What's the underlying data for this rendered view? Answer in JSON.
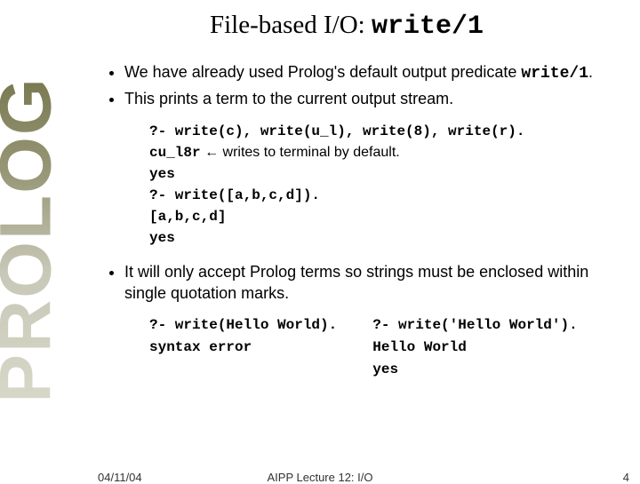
{
  "sidebar": {
    "label": "PROLOG"
  },
  "title": {
    "pre": "File-based I/O: ",
    "code": "write/1"
  },
  "bullets": {
    "b1a": "We have already used Prolog's default output predicate ",
    "b1b": "write/1",
    "b1c": ".",
    "b2": "This prints a term to the current output stream.",
    "b3": "It will only accept Prolog terms so strings must be enclosed within single quotation marks."
  },
  "code1": {
    "l1": "?- write(c), write(u_l), write(8), write(r).",
    "l2_code": "cu_l8r",
    "l2_arrow": "  ←  ",
    "l2_note": "writes to terminal by default.",
    "l3": "yes",
    "l4": "?- write([a,b,c,d]).",
    "l5": "[a,b,c,d]",
    "l6": "yes"
  },
  "code2": {
    "left_l1": "?- write(Hello World).",
    "left_l2": "syntax error",
    "right_l1": "?- write('Hello World').",
    "right_l2": "Hello World",
    "right_l3": "yes"
  },
  "footer": {
    "date": "04/11/04",
    "center": "AIPP Lecture 12: I/O",
    "page": "4"
  }
}
